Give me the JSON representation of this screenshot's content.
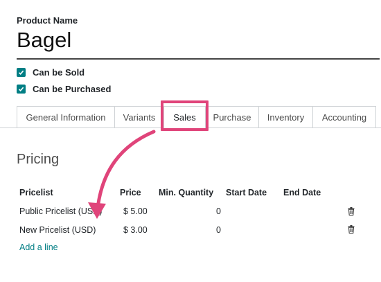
{
  "product": {
    "name_label": "Product Name",
    "name": "Bagel",
    "can_be_sold": "Can be Sold",
    "can_be_purchased": "Can be Purchased"
  },
  "tabs": [
    {
      "label": "General Information"
    },
    {
      "label": "Variants"
    },
    {
      "label": "Sales"
    },
    {
      "label": "Purchase"
    },
    {
      "label": "Inventory"
    },
    {
      "label": "Accounting"
    }
  ],
  "active_tab": "Sales",
  "pricing": {
    "title": "Pricing",
    "columns": {
      "pricelist": "Pricelist",
      "price": "Price",
      "min_qty": "Min. Quantity",
      "start": "Start Date",
      "end": "End Date"
    },
    "rows": [
      {
        "pricelist": "Public Pricelist (USD)",
        "price": "$ 5.00",
        "min_qty": "0"
      },
      {
        "pricelist": "New Pricelist (USD)",
        "price": "$ 3.00",
        "min_qty": "0"
      }
    ],
    "add_line": "Add a line"
  },
  "colors": {
    "accent": "#017e84",
    "annotation": "#e0447a"
  },
  "icons": {
    "checkbox": "check-icon",
    "delete": "trash-icon"
  }
}
